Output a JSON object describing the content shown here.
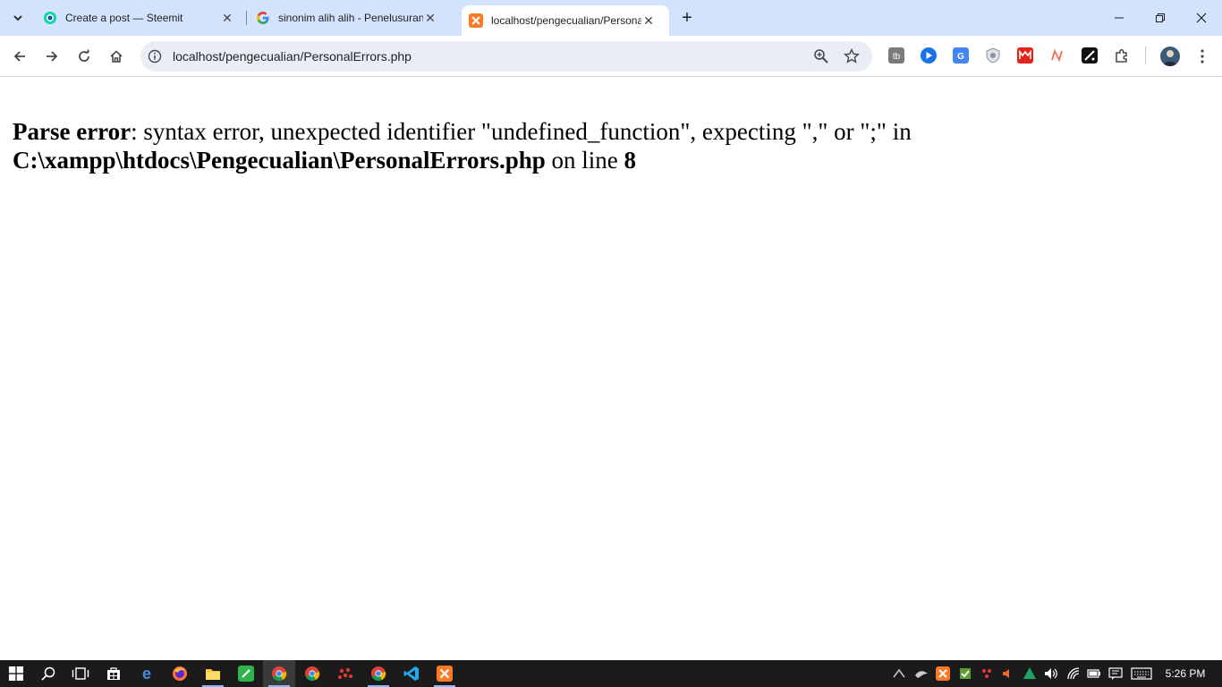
{
  "browser": {
    "tabs": [
      {
        "title": "Create a post — Steemit",
        "active": false,
        "favicon": "steemit-icon"
      },
      {
        "title": "sinonim alih alih - Penelusuran Google",
        "active": false,
        "favicon": "google-icon"
      },
      {
        "title": "localhost/pengecualian/PersonalErrors.php",
        "active": true,
        "favicon": "xampp-icon"
      }
    ],
    "address_bar": {
      "url": "localhost/pengecualian/PersonalErrors.php"
    },
    "extensions": [
      "ext-1-icon",
      "ext-2-icon",
      "google-translate-icon",
      "shield-icon",
      "ext-red-icon",
      "ext-n-icon",
      "ext-slash-icon",
      "puzzle-icon"
    ]
  },
  "page": {
    "error_label": "Parse error",
    "error_message": ": syntax error, unexpected identifier \"undefined_function\", expecting \",\" or \";\" in",
    "file_path": "C:\\xampp\\htdocs\\Pengecualian\\PersonalErrors.php",
    "on_line_text": " on line ",
    "line_number": "8"
  },
  "taskbar": {
    "clock": "5:26 PM",
    "apps": [
      "start-icon",
      "search-icon",
      "task-view-icon",
      "store-icon",
      "edge-icon",
      "firefox-icon",
      "file-explorer-icon",
      "green-app-icon",
      "chrome-icon",
      "chrome-icon-2",
      "red-app-icon",
      "chrome-icon-3",
      "vscode-icon",
      "xampp-icon"
    ]
  },
  "colors": {
    "tabstrip": "#d3e3fd",
    "omnibox": "#e9eef6",
    "taskbar": "#1b1b1b",
    "error_text": "#000000"
  }
}
